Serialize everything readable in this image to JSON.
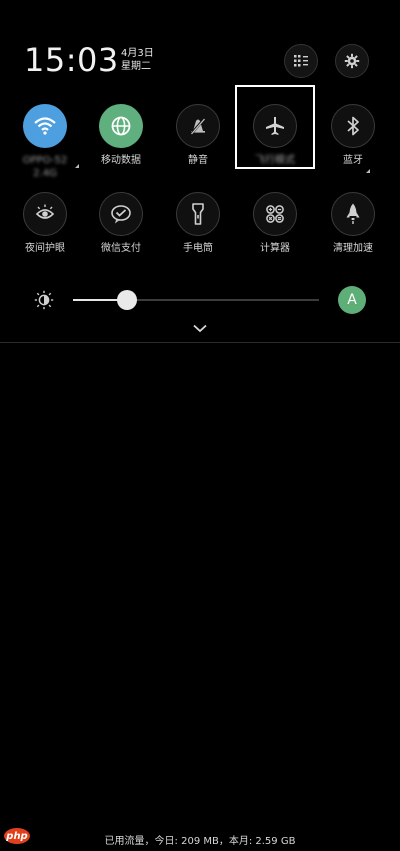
{
  "status": {
    "time": "15:03",
    "date": "4月3日",
    "weekday": "星期二"
  },
  "top_buttons": [
    {
      "icon": "grid-edit-icon"
    },
    {
      "icon": "gear-icon"
    }
  ],
  "quick_settings": {
    "row1": [
      {
        "icon": "wifi-icon",
        "label": "OPPO-52",
        "sublabel": "2.4G",
        "state": "on",
        "color": "#4d9fe0"
      },
      {
        "icon": "globe-icon",
        "label": "移动数据",
        "state": "on",
        "color": "#5fb07e"
      },
      {
        "icon": "mute-icon",
        "label": "静音",
        "state": "off"
      },
      {
        "icon": "airplane-icon",
        "label": "飞行模式",
        "state": "off"
      },
      {
        "icon": "bluetooth-icon",
        "label": "蓝牙",
        "state": "off"
      }
    ],
    "row2": [
      {
        "icon": "eye-care-icon",
        "label": "夜间护眼"
      },
      {
        "icon": "wechat-pay-icon",
        "label": "微信支付"
      },
      {
        "icon": "flashlight-icon",
        "label": "手电筒"
      },
      {
        "icon": "calculator-icon",
        "label": "计算器"
      },
      {
        "icon": "rocket-icon",
        "label": "清理加速"
      }
    ]
  },
  "brightness": {
    "level": 0.22,
    "auto_label": "A",
    "auto_color": "#5eae78"
  },
  "footer": {
    "data_usage": "已用流量，今日: 209 MB，本月: 2.59 GB"
  },
  "watermark": "php"
}
